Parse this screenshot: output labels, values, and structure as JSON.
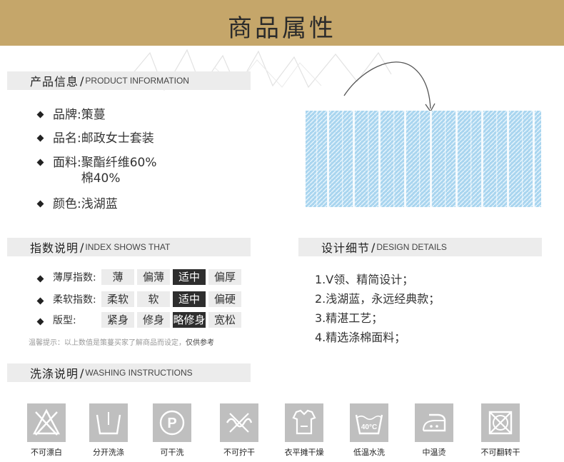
{
  "banner": {
    "title": "商品属性"
  },
  "product_info": {
    "header_zh": "产品信息",
    "slash": "/",
    "header_en": "PRODUCT INFORMATION",
    "items": [
      {
        "label": "品牌:",
        "value": "策蔓"
      },
      {
        "label": "品名:",
        "value": "邮政女士套装"
      },
      {
        "label": "面料:",
        "value": "聚酯纤维60%",
        "value2": "棉40%"
      },
      {
        "label": "颜色:",
        "value": "浅湖蓝"
      }
    ]
  },
  "index": {
    "header_zh": "指数说明",
    "slash": "/",
    "header_en": "INDEX SHOWS THAT",
    "rows": [
      {
        "label": "薄厚指数:",
        "options": [
          "薄",
          "偏薄",
          "适中",
          "偏厚"
        ],
        "selected": "适中"
      },
      {
        "label": "柔软指数:",
        "options": [
          "柔软",
          "软",
          "适中",
          "偏硬"
        ],
        "selected": "适中"
      },
      {
        "label": "版型:",
        "options": [
          "紧身",
          "修身",
          "略修身",
          "宽松"
        ],
        "selected": "略修身"
      }
    ],
    "note_prefix": "温馨提示：以上数值是策蔓买家了解商品而设定，",
    "note_emphasis": "仅供参考"
  },
  "design": {
    "header_zh": "设计细节",
    "slash": "/",
    "header_en": "DESIGN DETAILS",
    "items": [
      "1.V领、精简设计；",
      "2.浅湖蓝，永远经典款；",
      "3.精湛工艺；",
      "4.精选涤棉面料；"
    ]
  },
  "washing": {
    "header_zh": "洗涤说明",
    "slash": "/",
    "header_en": "WASHING INSTRUCTIONS",
    "items": [
      {
        "icon": "no-bleach-icon",
        "label": "不可漂白"
      },
      {
        "icon": "separate-wash-icon",
        "label": "分开洗涤"
      },
      {
        "icon": "dry-clean-icon",
        "label": "可干洗"
      },
      {
        "icon": "no-wring-icon",
        "label": "不可拧干"
      },
      {
        "icon": "flat-dry-icon",
        "label": "衣平摊干燥"
      },
      {
        "icon": "low-temp-wash-icon",
        "label": "低温水洗",
        "icon_text": "40°C"
      },
      {
        "icon": "medium-iron-icon",
        "label": "中温烫"
      },
      {
        "icon": "no-tumble-dry-icon",
        "label": "不可翻转干"
      }
    ]
  },
  "colors": {
    "banner": "#c5a66a",
    "section_bar": "#ececec",
    "chip_selected": "#2e2e2e",
    "icon_tile": "#bfbfbf",
    "fabric_blue": "#a8d4ee"
  }
}
